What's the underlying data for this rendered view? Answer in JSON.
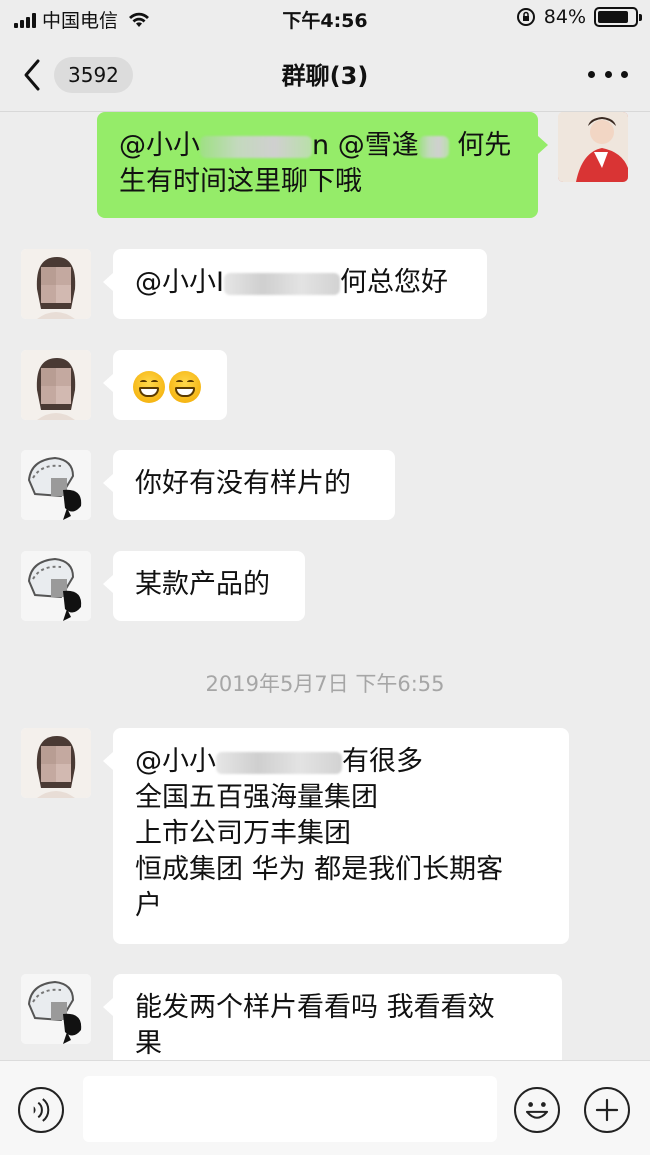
{
  "status_bar": {
    "carrier": "中国电信",
    "time": "下午4:56",
    "battery": "84%",
    "battery_level": 0.84
  },
  "nav": {
    "back_count": "3592",
    "title": "群聊(3)"
  },
  "messages": [
    {
      "side": "right",
      "lines": [
        {
          "parts": [
            "@小小",
            "",
            "n @雪逢",
            "",
            " 何先"
          ]
        },
        {
          "parts": [
            "生有时间这里聊下哦"
          ]
        }
      ]
    },
    {
      "side": "left",
      "avatar": "female-avatar",
      "lines": [
        {
          "parts": [
            "@小小I",
            "",
            "何总您好"
          ]
        }
      ]
    },
    {
      "side": "left",
      "avatar": "female-avatar",
      "emoji": [
        "grin-emoji",
        "grin-emoji"
      ]
    },
    {
      "side": "left",
      "avatar": "cartoon-avatar",
      "lines": [
        {
          "parts": [
            "你好有没有样片的"
          ]
        }
      ]
    },
    {
      "side": "left",
      "avatar": "cartoon-avatar",
      "lines": [
        {
          "parts": [
            "某款产品的"
          ]
        }
      ]
    },
    {
      "side": "left",
      "avatar": "female-avatar",
      "lines": [
        {
          "parts": [
            "@小小",
            "",
            "有很多"
          ]
        },
        {
          "parts": [
            "全国五百强海量集团"
          ]
        },
        {
          "parts": [
            "上市公司万丰集团"
          ]
        },
        {
          "parts": [
            "恒成集团  华为 都是我们长期客"
          ]
        },
        {
          "parts": [
            "户"
          ]
        }
      ]
    },
    {
      "side": "left",
      "avatar": "cartoon-avatar",
      "lines": [
        {
          "parts": [
            "能发两个样片看看吗  我看看效"
          ]
        },
        {
          "parts": [
            "果"
          ]
        }
      ]
    }
  ],
  "timestamp": "2019年5月7日 下午6:55",
  "input_bar": {
    "voice_icon": "voice-icon",
    "emoji_icon": "smile-icon",
    "plus_icon": "plus-icon",
    "placeholder": ""
  }
}
